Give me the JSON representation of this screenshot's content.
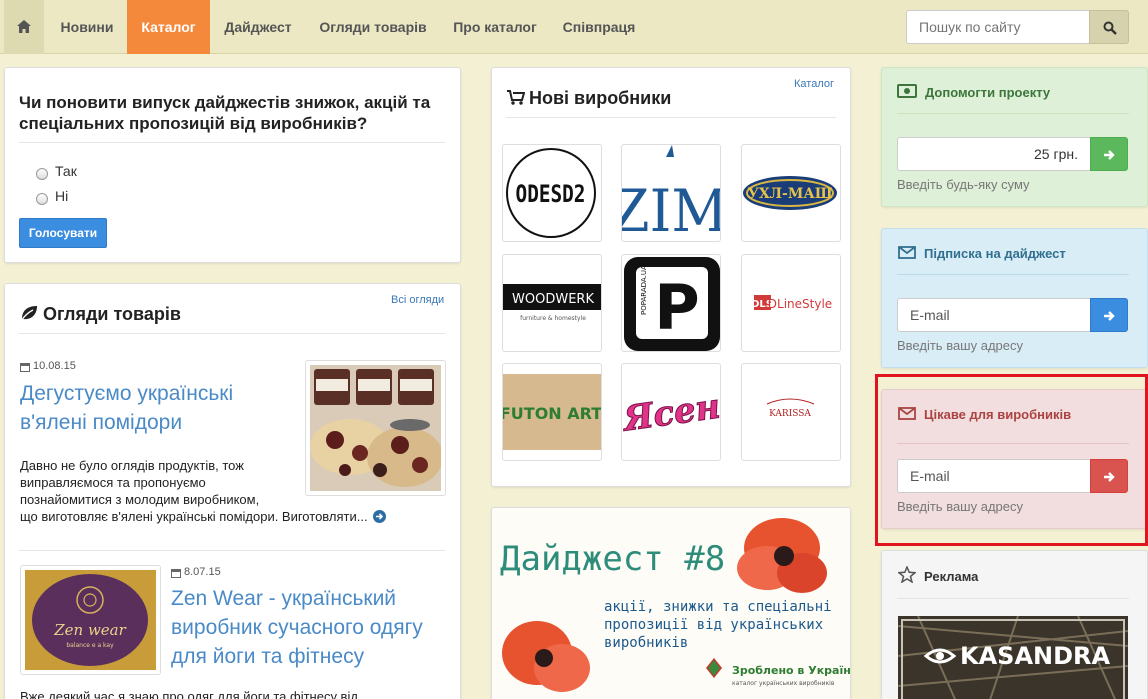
{
  "nav": {
    "items": [
      "Новини",
      "Каталог",
      "Дайджест",
      "Огляди товарів",
      "Про каталог",
      "Співпраця"
    ],
    "active_index": 1,
    "search_placeholder": "Пошук по сайту"
  },
  "poll": {
    "question": "Чи поновити випуск дайджестів знижок, акцій та спеціальних пропозицій від виробників?",
    "options": [
      "Так",
      "Ні"
    ],
    "vote_label": "Голосувати"
  },
  "reviews": {
    "title": "Огляди товарів",
    "all_link": "Всі огляди",
    "articles": [
      {
        "date": "10.08.15",
        "title_lines": [
          "Дегустуємо українські",
          "в'ялені помідори"
        ],
        "text_lines": [
          "Давно не було оглядів продуктів, тож",
          "виправляємося та пропонуємо",
          "познайомитися з молодим виробником,",
          "що виготовляє в'ялені українські помідори. Виготовляти..."
        ]
      },
      {
        "date": "8.07.15",
        "title_lines": [
          "Zen Wear - український",
          "виробник сучасного одягу",
          "для йоги та фітнесу"
        ],
        "text_lines": [
          "Вже деякий час я знаю про одяг для йоги та фітнесу від"
        ]
      }
    ]
  },
  "manufacturers": {
    "title": "Нові виробники",
    "catalog_link": "Каталог",
    "logos": [
      "ODESD2",
      "ZIM",
      "УХЛ-МАШ",
      "WOODWERK",
      "P",
      "DLineStyle",
      "FUTON ART",
      "Ясен",
      "KARISSA"
    ],
    "woodwerk_tagline": "furniture & homestyle",
    "poparada": "POPARADA.UA",
    "dls_badge": "DLS"
  },
  "digest": {
    "title": "Дайджест #8",
    "subtitle_lines": [
      "акції, знижки та спеціальні",
      "пропозиції від українських",
      "виробників"
    ],
    "badge": "Зроблено в Україні",
    "badge_sub": "каталог українських виробників"
  },
  "donate": {
    "title": "Допомогти проекту",
    "amount": "25  грн.",
    "help": "Введіть будь-яку суму"
  },
  "subscribe": {
    "title": "Підписка на дайджест",
    "placeholder": "E-mail",
    "help": "Введіть вашу адресу"
  },
  "producers": {
    "title": "Цікаве для виробників",
    "placeholder": "E-mail",
    "help": "Введіть вашу адресу"
  },
  "ads": {
    "title": "Реклама",
    "banner_text": "KASANDRA"
  },
  "colors": {
    "accent_orange": "#f4893c",
    "link_blue": "#4a8ac7",
    "button_blue": "#3b8de0",
    "green": "#5cb85c",
    "red": "#d9534f",
    "highlight_red": "#e0141e"
  }
}
